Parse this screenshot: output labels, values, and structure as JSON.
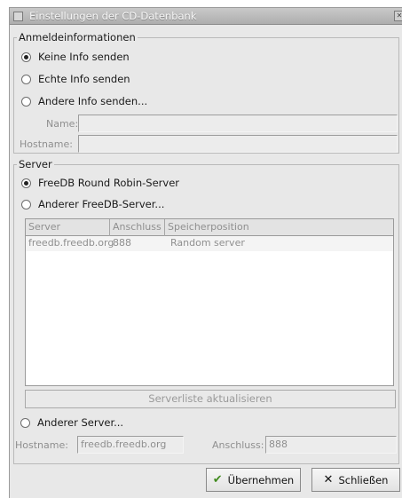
{
  "window": {
    "title": "Einstellungen der CD-Datenbank"
  },
  "login": {
    "frame_label": "Anmeldeinformationen",
    "options": [
      "Keine Info senden",
      "Echte Info senden",
      "Andere Info senden..."
    ],
    "selected": 0,
    "name_label": "Name:",
    "name_value": "",
    "hostname_label": "Hostname:",
    "hostname_value": ""
  },
  "server": {
    "frame_label": "Server",
    "options": [
      "FreeDB Round Robin-Server",
      "Anderer FreeDB-Server..."
    ],
    "selected": 0,
    "table": {
      "columns": [
        "Server",
        "Anschluss",
        "Speicherposition"
      ],
      "rows": [
        [
          "freedb.freedb.org",
          "888",
          "Random server"
        ]
      ]
    },
    "refresh_button": "Serverliste aktualisieren",
    "other_server_label": "Anderer Server...",
    "hostname_label": "Hostname:",
    "hostname_value": "freedb.freedb.org",
    "port_label": "Anschluss:",
    "port_value": "888"
  },
  "buttons": {
    "apply": "Übernehmen",
    "close": "Schließen"
  },
  "icons": {
    "apply": "checkmark-icon",
    "close": "x-icon"
  },
  "colors": {
    "titlebar": "#b8b8b8",
    "background": "#e8e8e8",
    "disabled_text": "#8f8f8f"
  }
}
